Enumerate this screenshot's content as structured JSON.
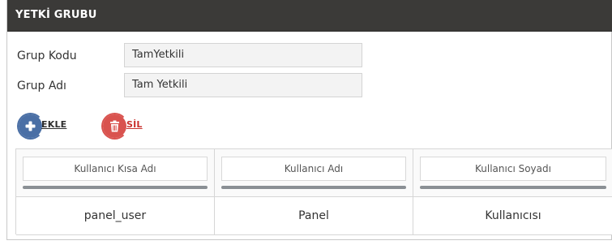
{
  "header": {
    "title": "YETKİ GRUBU"
  },
  "form": {
    "group_code": {
      "label": "Grup Kodu",
      "value": "TamYetkili"
    },
    "group_name": {
      "label": "Grup Adı",
      "value": "Tam Yetkili"
    }
  },
  "toolbar": {
    "add_label": "EKLE",
    "add_icon": "plus-icon",
    "add_color": "#4a6fa5",
    "delete_label": "SİL",
    "delete_icon": "trash-icon",
    "delete_color": "#d9534f"
  },
  "table": {
    "columns": [
      "Kullanıcı Kısa Adı",
      "Kullanıcı Adı",
      "Kullanıcı Soyadı"
    ],
    "rows": [
      [
        "panel_user",
        "Panel",
        "Kullanıcısı"
      ]
    ]
  }
}
